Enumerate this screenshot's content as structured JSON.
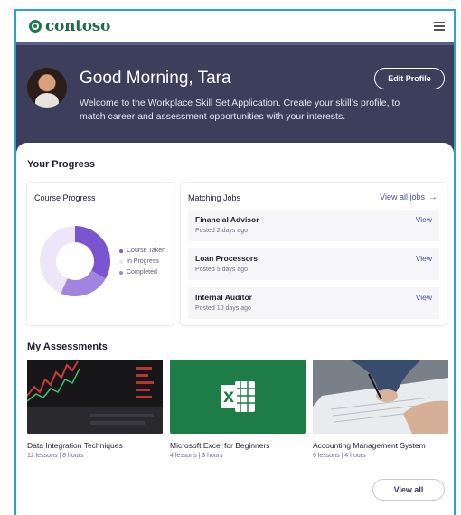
{
  "brand": {
    "name": "contoso"
  },
  "hero": {
    "greeting": "Good Morning, Tara",
    "welcome": "Welcome to the Workplace Skill Set Application. Create your skill’s profile, to match career and assessment opportunities with your interests.",
    "edit_label": "Edit Profile"
  },
  "progress": {
    "title": "Your Progress",
    "course_card_title": "Course Progress",
    "legend": [
      {
        "label": "Course Taken",
        "color": "#7b55cf"
      },
      {
        "label": "In Progress",
        "color": "#ece6f8"
      },
      {
        "label": "Completed",
        "color": "#9f84e0"
      }
    ]
  },
  "jobs": {
    "title": "Matching Jobs",
    "view_all": "View all jobs",
    "items": [
      {
        "title": "Financial Advisor",
        "posted": "Posted 2 days ago",
        "action": "View"
      },
      {
        "title": "Loan Processors",
        "posted": "Posted 5 days ago",
        "action": "View"
      },
      {
        "title": "Internal Auditor",
        "posted": "Posted 10 days ago",
        "action": "View"
      }
    ]
  },
  "assessments": {
    "title": "My Assessments",
    "items": [
      {
        "name": "Data Integration Techniques",
        "meta": "12 lessons | 8 hours",
        "image": "stock-chart-image"
      },
      {
        "name": "Microsoft Excel for Beginners",
        "meta": "4 lessons | 3 hours",
        "image": "excel-logo-image"
      },
      {
        "name": "Accounting Management System",
        "meta": "6 lessons | 4 hours",
        "image": "signing-document-image"
      }
    ],
    "view_all": "View all"
  },
  "colors": {
    "accent": "#4b4fa8",
    "hero": "#3d3d5c",
    "excel": "#1e7d46",
    "brand": "#1f6b4a"
  }
}
